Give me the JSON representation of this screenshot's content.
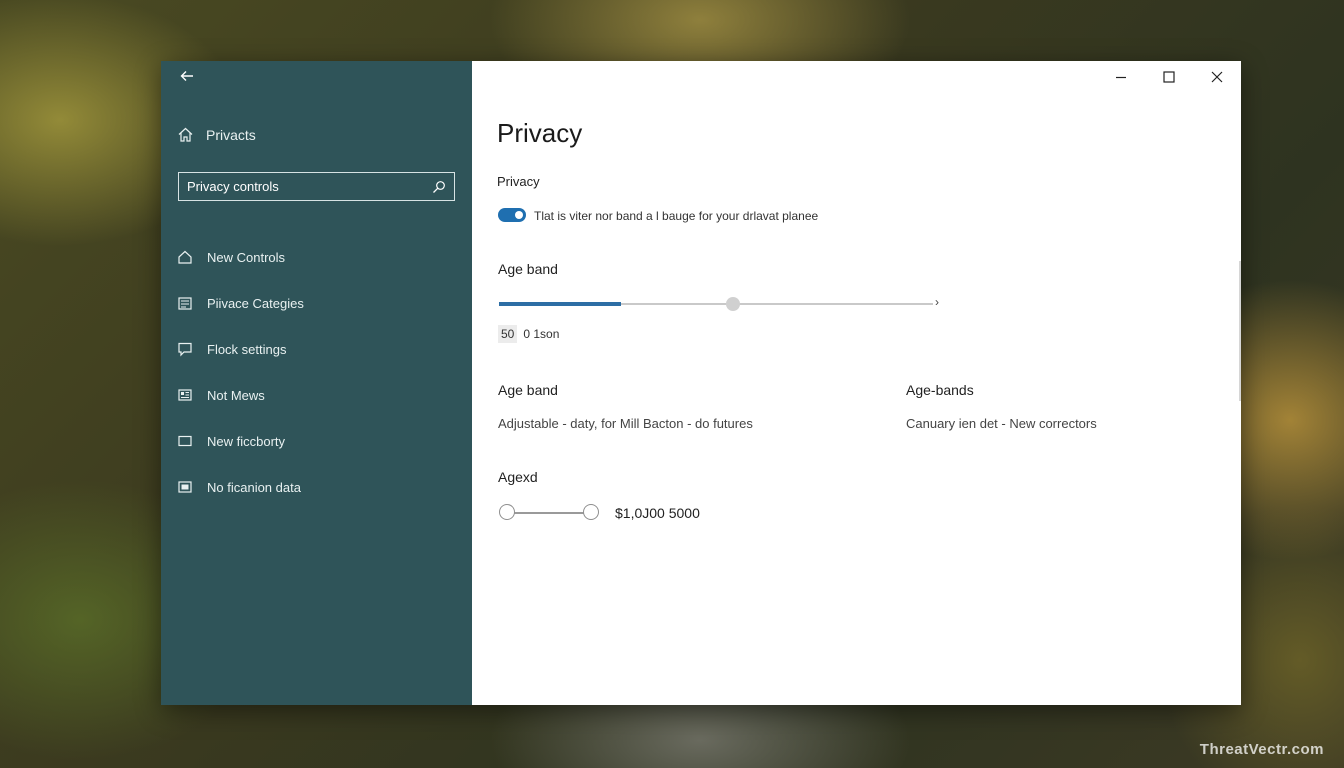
{
  "sidebar": {
    "home_label": "Privacts",
    "search": {
      "value": "",
      "placeholder": "Privacy controls"
    },
    "items": [
      {
        "label": "New Controls",
        "icon": "home-outline-icon"
      },
      {
        "label": "Piivace Categies",
        "icon": "categories-icon"
      },
      {
        "label": "Flock settings",
        "icon": "chat-settings-icon"
      },
      {
        "label": "Not Mews",
        "icon": "news-icon"
      },
      {
        "label": "New ficcborty",
        "icon": "window-icon"
      },
      {
        "label": "No ficanion data",
        "icon": "data-icon"
      }
    ]
  },
  "main": {
    "title": "Privacy",
    "privacy_section": {
      "label": "Privacy",
      "toggle_on": true,
      "toggle_text": "Tlat is viter nor band a l bauge for your drlavat planee"
    },
    "age_band_1": {
      "label": "Age band",
      "slider_fill_fraction": 0.28,
      "slider_thumb_fraction": 0.54,
      "value_number": "50",
      "value_text": "0 1son"
    },
    "age_band_2": {
      "label": "Age band",
      "description": "Adjustable - daty, for Mill Bacton - do futures"
    },
    "age_bands": {
      "label": "Age-bands",
      "description": "Canuary ien det - New correctors"
    },
    "aged": {
      "label": "Agexd",
      "value": "$1,0J00 5000"
    }
  },
  "watermark": "ThreatVectr.com",
  "colors": {
    "sidebar_bg": "#2f5459",
    "accent": "#1f6fb0"
  }
}
